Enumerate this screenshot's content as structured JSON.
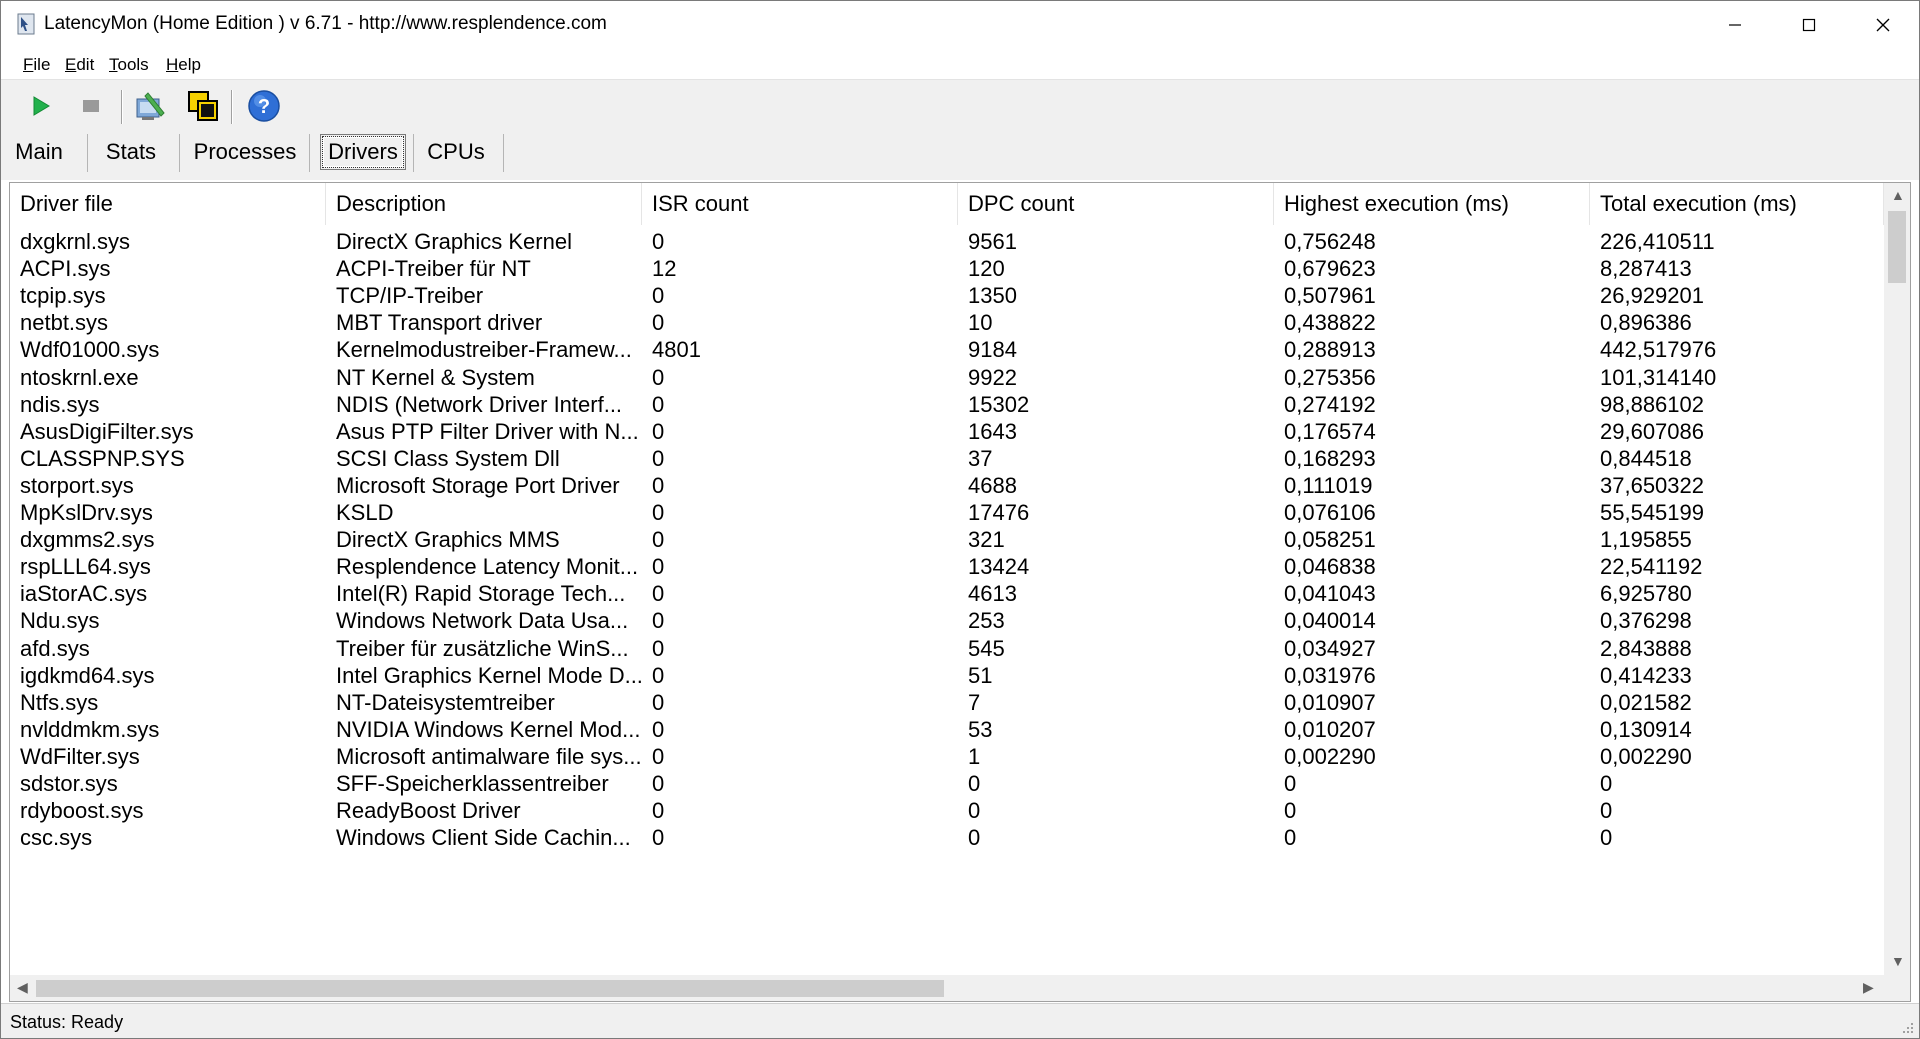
{
  "window": {
    "title": "LatencyMon  (Home Edition )  v 6.71 - http://www.resplendence.com"
  },
  "menu": {
    "items": [
      {
        "label": "File",
        "accel": "F",
        "rest": "ile"
      },
      {
        "label": "Edit",
        "accel": "E",
        "rest": "dit"
      },
      {
        "label": "Tools",
        "accel": "T",
        "rest": "ools"
      },
      {
        "label": "Help",
        "accel": "H",
        "rest": "elp"
      }
    ]
  },
  "toolbar": {
    "icons": [
      "play-icon",
      "stop-icon",
      "analyze-icon",
      "copy-windows-icon",
      "help-icon"
    ]
  },
  "tabs": [
    {
      "label": "Main",
      "active": false
    },
    {
      "label": "Stats",
      "active": false
    },
    {
      "label": "Processes",
      "active": false
    },
    {
      "label": "Drivers",
      "active": true
    },
    {
      "label": "CPUs",
      "active": false
    }
  ],
  "table": {
    "columns": [
      "Driver file",
      "Description",
      "ISR count",
      "DPC count",
      "Highest execution (ms)",
      "Total execution (ms)"
    ],
    "rows": [
      [
        "dxgkrnl.sys",
        "DirectX Graphics Kernel",
        "0",
        "9561",
        "0,756248",
        "226,410511"
      ],
      [
        "ACPI.sys",
        "ACPI-Treiber für NT",
        "12",
        "120",
        "0,679623",
        "8,287413"
      ],
      [
        "tcpip.sys",
        "TCP/IP-Treiber",
        "0",
        "1350",
        "0,507961",
        "26,929201"
      ],
      [
        "netbt.sys",
        "MBT Transport driver",
        "0",
        "10",
        "0,438822",
        "0,896386"
      ],
      [
        "Wdf01000.sys",
        "Kernelmodustreiber-Framew...",
        "4801",
        "9184",
        "0,288913",
        "442,517976"
      ],
      [
        "ntoskrnl.exe",
        "NT Kernel & System",
        "0",
        "9922",
        "0,275356",
        "101,314140"
      ],
      [
        "ndis.sys",
        "NDIS (Network Driver Interf...",
        "0",
        "15302",
        "0,274192",
        "98,886102"
      ],
      [
        "AsusDigiFilter.sys",
        "Asus PTP Filter Driver with N...",
        "0",
        "1643",
        "0,176574",
        "29,607086"
      ],
      [
        "CLASSPNP.SYS",
        "SCSI Class System Dll",
        "0",
        "37",
        "0,168293",
        "0,844518"
      ],
      [
        "storport.sys",
        "Microsoft Storage Port Driver",
        "0",
        "4688",
        "0,111019",
        "37,650322"
      ],
      [
        "MpKslDrv.sys",
        "KSLD",
        "0",
        "17476",
        "0,076106",
        "55,545199"
      ],
      [
        "dxgmms2.sys",
        "DirectX Graphics MMS",
        "0",
        "321",
        "0,058251",
        "1,195855"
      ],
      [
        "rspLLL64.sys",
        "Resplendence Latency Monit...",
        "0",
        "13424",
        "0,046838",
        "22,541192"
      ],
      [
        "iaStorAC.sys",
        "Intel(R) Rapid Storage Tech...",
        "0",
        "4613",
        "0,041043",
        "6,925780"
      ],
      [
        "Ndu.sys",
        "Windows Network Data Usa...",
        "0",
        "253",
        "0,040014",
        "0,376298"
      ],
      [
        "afd.sys",
        "Treiber für zusätzliche WinS...",
        "0",
        "545",
        "0,034927",
        "2,843888"
      ],
      [
        "igdkmd64.sys",
        "Intel Graphics Kernel Mode D...",
        "0",
        "51",
        "0,031976",
        "0,414233"
      ],
      [
        "Ntfs.sys",
        "NT-Dateisystemtreiber",
        "0",
        "7",
        "0,010907",
        "0,021582"
      ],
      [
        "nvlddmkm.sys",
        "NVIDIA Windows Kernel Mod...",
        "0",
        "53",
        "0,010207",
        "0,130914"
      ],
      [
        "WdFilter.sys",
        "Microsoft antimalware file sys...",
        "0",
        "1",
        "0,002290",
        "0,002290"
      ],
      [
        "sdstor.sys",
        "SFF-Speicherklassentreiber",
        "0",
        "0",
        "0",
        "0"
      ],
      [
        "rdyboost.sys",
        "ReadyBoost Driver",
        "0",
        "0",
        "0",
        "0"
      ],
      [
        "csc.sys",
        "Windows Client Side Cachin...",
        "0",
        "0",
        "0",
        "0"
      ]
    ]
  },
  "status": {
    "text": "Status: Ready"
  }
}
